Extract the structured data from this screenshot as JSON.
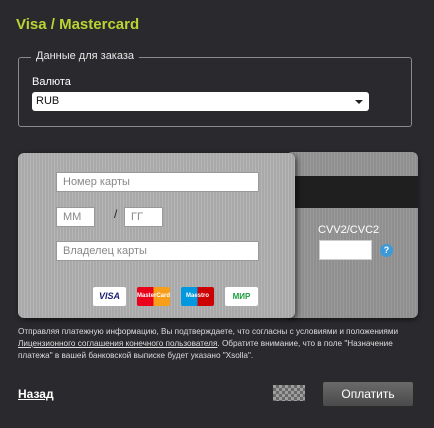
{
  "title": "Visa / Mastercard",
  "order": {
    "legend": "Данные для заказа",
    "currency_label": "Валюта",
    "currency_value": "RUB"
  },
  "card": {
    "number_placeholder": "Номер карты",
    "month_placeholder": "ММ",
    "slash": "/",
    "year_placeholder": "ГГ",
    "holder_placeholder": "Владелец карты",
    "cvv_label": "CVV2/CVC2",
    "help": "?"
  },
  "logos": [
    "VISA",
    "MasterCard",
    "Maestro",
    "МИР"
  ],
  "notice": {
    "part1": "Отправляя платежную информацию, Вы подтверждаете, что согласны с условиями и положениями ",
    "link": "Лицензионного соглашения конечного пользователя",
    "part2": ". Обратите внимание, что в поле \"Назначение платежа\" в вашей банковской выписке будет указано \"Xsolla\"."
  },
  "actions": {
    "back": "Назад",
    "pay": "Оплатить"
  }
}
